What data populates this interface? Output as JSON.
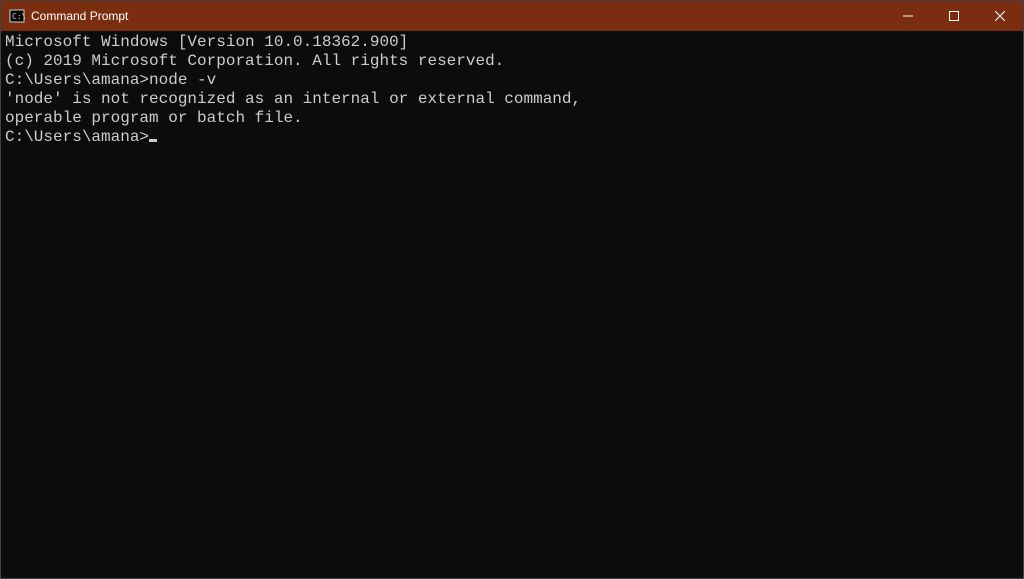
{
  "titlebar": {
    "title": "Command Prompt"
  },
  "terminal": {
    "line1": "Microsoft Windows [Version 10.0.18362.900]",
    "line2": "(c) 2019 Microsoft Corporation. All rights reserved.",
    "blank1": "",
    "prompt1_path": "C:\\Users\\amana>",
    "prompt1_cmd": "node -v",
    "error1": "'node' is not recognized as an internal or external command,",
    "error2": "operable program or batch file.",
    "blank2": "",
    "prompt2_path": "C:\\Users\\amana>"
  }
}
